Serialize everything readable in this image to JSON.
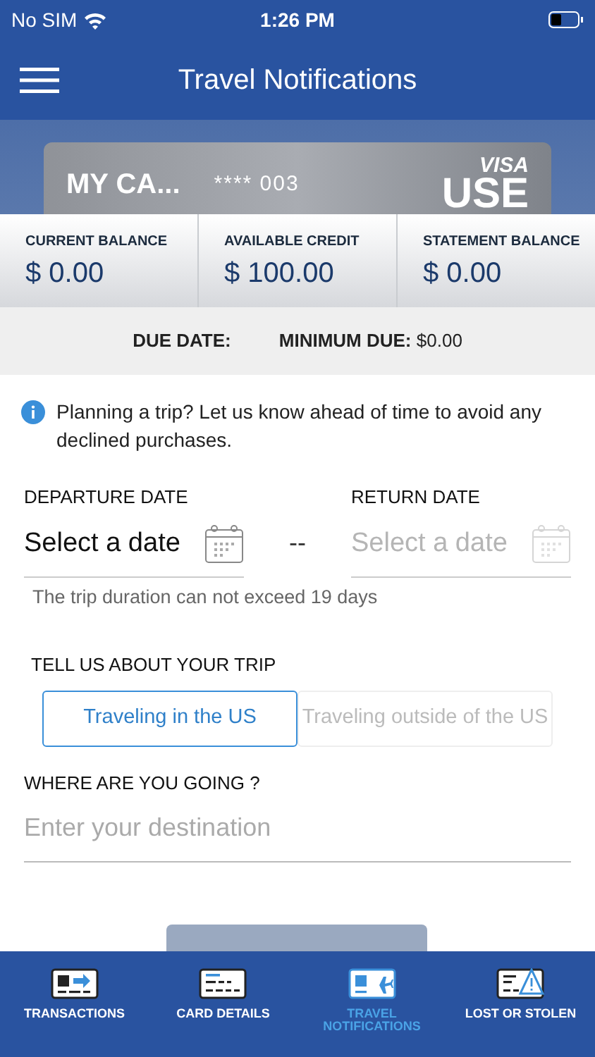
{
  "status_bar": {
    "carrier": "No SIM",
    "time": "1:26 PM"
  },
  "header": {
    "title": "Travel Notifications"
  },
  "card": {
    "name": "MY CA...",
    "number": "**** 003",
    "brand_top": "VISA",
    "brand_bottom": "USE"
  },
  "balances": [
    {
      "label": "CURRENT BALANCE",
      "value": "$ 0.00"
    },
    {
      "label": "AVAILABLE CREDIT",
      "value": "$ 100.00"
    },
    {
      "label": "STATEMENT BALANCE",
      "value": "$ 0.00"
    }
  ],
  "due": {
    "due_label": "DUE DATE:",
    "minimum_label": "MINIMUM DUE:",
    "minimum_value": "$0.00"
  },
  "info": "Planning a trip? Let us know ahead of time to avoid any declined purchases.",
  "dates": [
    {
      "label": "DEPARTURE DATE",
      "placeholder": "Select a date",
      "disabled": false
    },
    {
      "label": "RETURN DATE",
      "placeholder": "Select a date",
      "disabled": true
    }
  ],
  "date_separator": "--",
  "hint": "The trip duration can not exceed 19 days",
  "trip_label": "TELL US ABOUT YOUR TRIP",
  "trip_options": [
    {
      "label": "Traveling in the US",
      "selected": true
    },
    {
      "label": "Traveling outside of the US",
      "selected": false
    }
  ],
  "destination": {
    "label": "WHERE ARE YOU GOING ?",
    "placeholder": "Enter your destination"
  },
  "tab_bar": [
    {
      "label": "TRANSACTIONS",
      "kind": "transactions",
      "selected": false
    },
    {
      "label": "CARD DETAILS",
      "kind": "details",
      "selected": false
    },
    {
      "label": "TRAVEL NOTIFICATIONS",
      "kind": "travel",
      "selected": true
    },
    {
      "label": "LOST OR STOLEN",
      "kind": "lost",
      "selected": false
    }
  ]
}
